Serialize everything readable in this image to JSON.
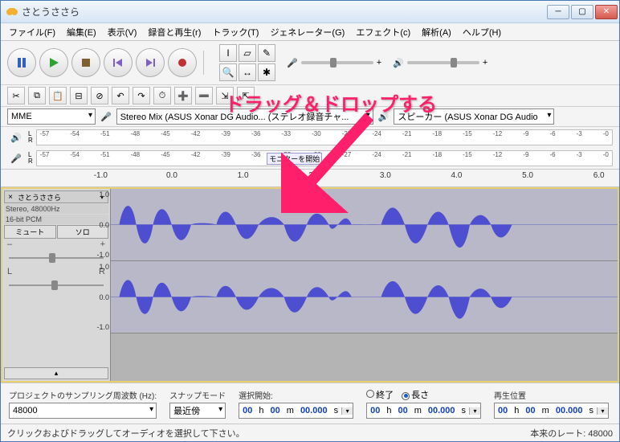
{
  "window": {
    "title": "さとうささら"
  },
  "menu": {
    "file": "ファイル(F)",
    "edit": "編集(E)",
    "view": "表示(V)",
    "record": "録音と再生(r)",
    "track": "トラック(T)",
    "generate": "ジェネレーター(G)",
    "effect": "エフェクト(c)",
    "analyze": "解析(A)",
    "help": "ヘルプ(H)"
  },
  "device": {
    "host": "MME",
    "input": "Stereo Mix (ASUS Xonar DG Audio... (ステレオ録音チャ...",
    "output": "スピーカー (ASUS Xonar DG Audio"
  },
  "meter": {
    "ticks": [
      "-57",
      "-54",
      "-51",
      "-48",
      "-45",
      "-42",
      "-39",
      "-36",
      "-33",
      "-30",
      "-27",
      "-24",
      "-21",
      "-18",
      "-15",
      "-12",
      "-9",
      "-6",
      "-3",
      "-0"
    ],
    "monitor_hint": "モニターを開始"
  },
  "ruler": {
    "ticks": [
      "-1.0",
      "0.0",
      "1.0",
      "2.0",
      "3.0",
      "4.0",
      "5.0",
      "6.0"
    ]
  },
  "track": {
    "name": "さとうささら",
    "format_line1": "Stereo, 48000Hz",
    "format_line2": "16-bit PCM",
    "mute": "ミュート",
    "solo": "ソロ",
    "pan_l": "L",
    "pan_r": "R",
    "scale": {
      "max": "1.0",
      "zero": "0.0",
      "min": "-1.0"
    }
  },
  "annotation": {
    "text": "ドラッグ＆ドロップする"
  },
  "bottom": {
    "project_rate_label": "プロジェクトのサンプリング周波数 (Hz):",
    "project_rate_value": "48000",
    "snap_label": "スナップモード",
    "snap_value": "最近傍",
    "sel_start_label": "選択開始:",
    "end_label": "終了",
    "length_label": "長さ",
    "play_pos_label": "再生位置",
    "time_h_prefix": "00",
    "time_h_unit": "h",
    "time_m_prefix": "00",
    "time_m_unit": "m",
    "time_s_prefix": "00.000",
    "time_s_unit": "s"
  },
  "status": {
    "hint": "クリックおよびドラッグしてオーディオを選択して下さい。",
    "rate_label": "本来のレート: 48000"
  }
}
